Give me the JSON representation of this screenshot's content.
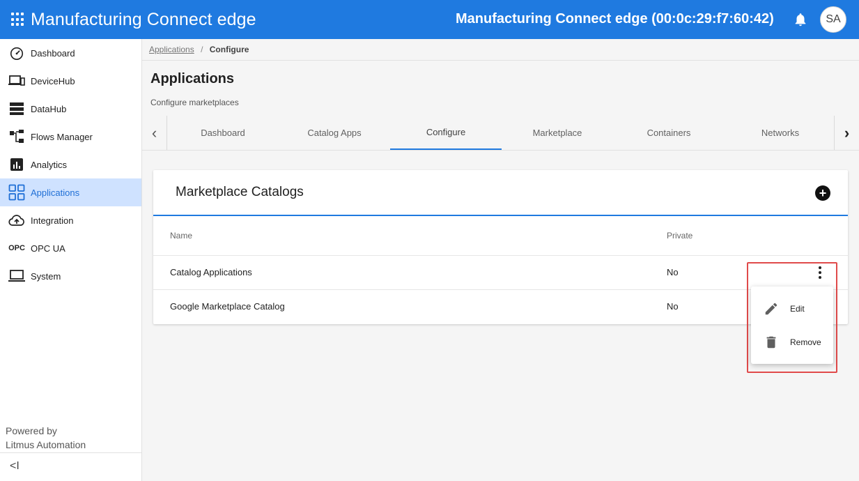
{
  "header": {
    "brand": "Manufacturing Connect edge",
    "device_title": "Manufacturing Connect edge (00:0c:29:f7:60:42)",
    "avatar": "SA"
  },
  "sidebar": {
    "items": [
      {
        "label": "Dashboard",
        "icon": "speedometer-icon"
      },
      {
        "label": "DeviceHub",
        "icon": "devices-icon"
      },
      {
        "label": "DataHub",
        "icon": "server-icon"
      },
      {
        "label": "Flows Manager",
        "icon": "flows-icon"
      },
      {
        "label": "Analytics",
        "icon": "analytics-icon"
      },
      {
        "label": "Applications",
        "icon": "apps-grid-icon"
      },
      {
        "label": "Integration",
        "icon": "cloud-upload-icon"
      },
      {
        "label": "OPC UA",
        "icon": "opc-icon"
      },
      {
        "label": "System",
        "icon": "laptop-icon"
      }
    ],
    "active": "Applications",
    "opc_icon_text": "OPC",
    "powered_by_line1": "Powered by",
    "powered_by_line2": "Litmus Automation",
    "collapse_glyph": "<I"
  },
  "breadcrumb": {
    "link": "Applications",
    "separator": "/",
    "current": "Configure"
  },
  "page": {
    "title": "Applications",
    "subtitle": "Configure marketplaces"
  },
  "tabs": {
    "items": [
      "Dashboard",
      "Catalog Apps",
      "Configure",
      "Marketplace",
      "Containers",
      "Networks"
    ],
    "active": "Configure",
    "left_arrow": "‹",
    "right_arrow": "›"
  },
  "card": {
    "title": "Marketplace Catalogs",
    "add_glyph": "+",
    "columns": [
      "Name",
      "Private"
    ],
    "rows": [
      {
        "name": "Catalog Applications",
        "private": "No"
      },
      {
        "name": "Google Marketplace Catalog",
        "private": "No"
      }
    ]
  },
  "menu": {
    "items": [
      {
        "label": "Edit",
        "icon": "pencil-icon"
      },
      {
        "label": "Remove",
        "icon": "trash-icon"
      }
    ]
  },
  "colors": {
    "brand": "#1f7ae0",
    "active_nav_bg": "#cfe2ff",
    "highlight": "#e04a4a"
  }
}
